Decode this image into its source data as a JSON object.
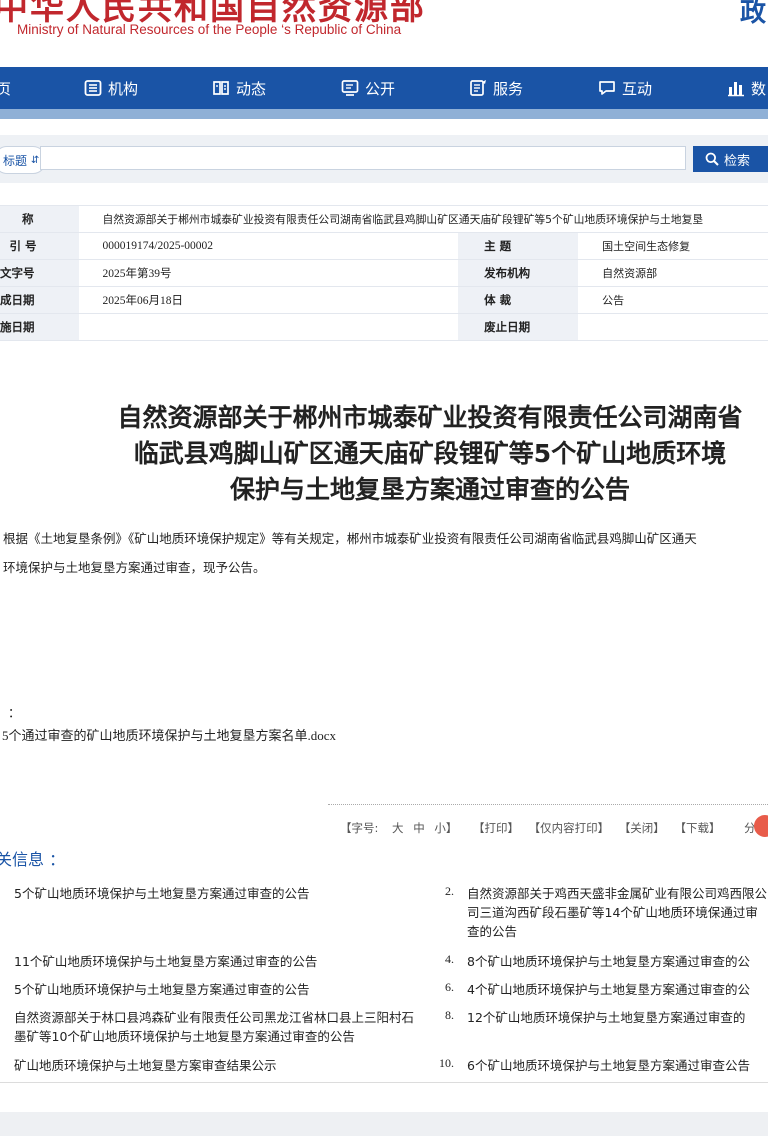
{
  "header": {
    "title": "中华人民共和国自然资源部",
    "subtitle": "Ministry of Natural Resources of the People ‘s Republic of China",
    "right_text": "政"
  },
  "nav": {
    "items": [
      {
        "label": "页",
        "icon": "home-icon"
      },
      {
        "label": "机构",
        "icon": "org-icon"
      },
      {
        "label": "动态",
        "icon": "news-icon"
      },
      {
        "label": "公开",
        "icon": "open-icon"
      },
      {
        "label": "服务",
        "icon": "service-icon"
      },
      {
        "label": "互动",
        "icon": "chat-icon"
      },
      {
        "label": "数",
        "icon": "data-icon"
      }
    ]
  },
  "search": {
    "select_value": "标题",
    "placeholder": "",
    "button_label": "检索"
  },
  "meta": {
    "name_key": "称",
    "name_value": "自然资源部关于郴州市城泰矿业投资有限责任公司湖南省临武县鸡脚山矿区通天庙矿段锂矿等5个矿山地质环境保护与土地复垦",
    "rows": [
      {
        "k1": "引  号",
        "v1": "000019174/2025-00002",
        "k2": "主      题",
        "v2": "国土空间生态修复"
      },
      {
        "k1": "文字号",
        "v1": "2025年第39号",
        "k2": "发布机构",
        "v2": "自然资源部"
      },
      {
        "k1": "成日期",
        "v1": "2025年06月18日",
        "k2": "体      裁",
        "v2": "公告"
      },
      {
        "k1": "施日期",
        "v1": "",
        "k2": "废止日期",
        "v2": ""
      }
    ]
  },
  "article": {
    "title_lines": [
      "自然资源部关于郴州市城泰矿业投资有限责任公司湖南省",
      "临武县鸡脚山矿区通天庙矿段锂矿等5个矿山地质环境",
      "保护与土地复垦方案通过审查的公告"
    ],
    "para1": "根据《土地复垦条例》《矿山地质环境保护规定》等有关规定，郴州市城泰矿业投资有限责任公司湖南省临武县鸡脚山矿区通天",
    "para2": "环境保护与土地复垦方案通过审查，现予公告。",
    "attach_label": "：",
    "attachment": "5个通过审查的矿山地质环境保护与土地复垦方案名单.docx"
  },
  "tools": {
    "font_label": "【字号:",
    "big": "大",
    "mid": "中",
    "small": "小】",
    "print": "【打印】",
    "print_content": "【仅内容打印】",
    "close": "【关闭】",
    "download": "【下载】",
    "share": "分享到"
  },
  "related": {
    "title": "关信息 ：",
    "left": [
      "5个矿山地质环境保护与土地复垦方案通过审查的公告",
      "11个矿山地质环境保护与土地复垦方案通过审查的公告",
      "5个矿山地质环境保护与土地复垦方案通过审查的公告",
      "自然资源部关于林口县鸿森矿业有限责任公司黑龙江省林口县上三阳村石墨矿等10个矿山地质环境保护与土地复垦方案通过审查的公告",
      "矿山地质环境保护与土地复垦方案审查结果公示"
    ],
    "right": [
      {
        "num": "2.",
        "text": "自然资源部关于鸡西天盛非金属矿业有限公司鸡西限公司三道沟西矿段石墨矿等14个矿山地质环境保通过审查的公告"
      },
      {
        "num": "4.",
        "text": "8个矿山地质环境保护与土地复垦方案通过审查的公"
      },
      {
        "num": "6.",
        "text": "4个矿山地质环境保护与土地复垦方案通过审查的公"
      },
      {
        "num": "8.",
        "text": "12个矿山地质环境保护与土地复垦方案通过审查的"
      },
      {
        "num": "10.",
        "text": "6个矿山地质环境保护与土地复垦方案通过审查公告"
      }
    ]
  },
  "colors": {
    "brand_red": "#c1272d",
    "brand_blue": "#1a54a6"
  }
}
